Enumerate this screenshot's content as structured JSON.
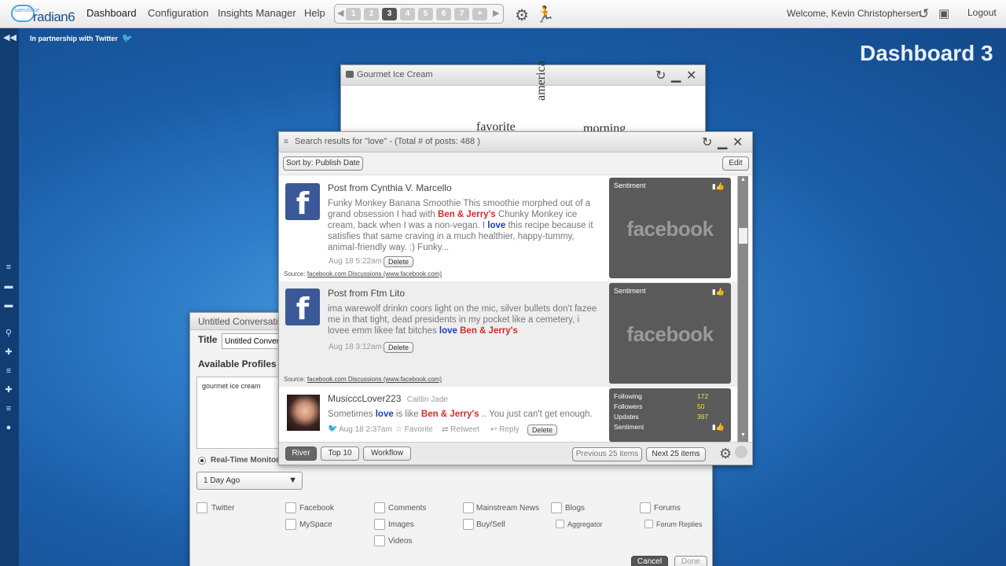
{
  "topbar": {
    "logo_small": "salesforce",
    "logo_text": "radian6",
    "nav": [
      "Dashboard",
      "Configuration",
      "Insights Manager",
      "Help"
    ],
    "pages": [
      "1",
      "2",
      "3",
      "4",
      "5",
      "6",
      "7",
      "+"
    ],
    "active_page": "3",
    "welcome": "Welcome, Kevin Christophersen",
    "logout": "Logout"
  },
  "partner_text": "In partnership with Twitter",
  "dashboard_title": "Dashboard 3",
  "cloud_window": {
    "title": "Gourmet Ice Cream",
    "words": [
      "favorite",
      "america",
      "morning"
    ]
  },
  "search_window": {
    "title": "Search results for \"love\" - (Total # of posts: 488 )",
    "sort_label": "Sort by: Publish Date",
    "edit_label": "Edit",
    "posts": [
      {
        "title": "Post from Cynthia V. Marcello",
        "body_parts": [
          "Funky Monkey Banana Smoothie This smoothie morphed out of a grand obsession I had with ",
          "Ben & Jerry's",
          " Chunky Monkey ice cream, back when I was a non-vegan. I ",
          "love",
          " this recipe because it satisfies that same craving in a much healthier, happy-tummy, animal-friendly way. :) Funky..."
        ],
        "time": "Aug 18 5:22am",
        "delete": "Delete",
        "source_label": "Source:",
        "source": "facebook.com Discussions (www.facebook.com)",
        "sentiment": "Sentiment",
        "brand": "facebook"
      },
      {
        "title": "Post from Ftm Lito",
        "body_parts": [
          "ima warewolf drinkn coors light on the mic, silver bullets don't fazee me in that tight, dead presidents in my pocket like a cemetery, i lovee emm likee fat bitches ",
          "love",
          " ",
          "Ben & Jerry's"
        ],
        "time": "Aug 18 3:12am",
        "delete": "Delete",
        "source_label": "Source:",
        "source": "facebook.com Discussions (www.facebook.com)",
        "sentiment": "Sentiment",
        "brand": "facebook"
      },
      {
        "title": "MusicccLover223",
        "subtitle": "Caitlin Jade",
        "body_parts": [
          "Sometimes ",
          "love",
          " is like ",
          "Ben & Jerry's",
          " .. You just can't get enough."
        ],
        "time": "Aug 18 2:37am",
        "favorite": "Favorite",
        "retweet": "Retweet",
        "reply": "Reply",
        "delete": "Delete",
        "stats": [
          {
            "label": "Following",
            "value": "172"
          },
          {
            "label": "Followers",
            "value": "50"
          },
          {
            "label": "Updates",
            "value": "397"
          }
        ],
        "sentiment": "Sentiment"
      }
    ],
    "tabs": [
      "River",
      "Top 10",
      "Workflow"
    ],
    "prev": "Previous 25 items",
    "next": "Next 25 items"
  },
  "conv_window": {
    "title": "Untitled Conversation",
    "title_label": "Title",
    "title_value": "Untitled Conversa",
    "profiles_label": "Available Profiles",
    "profiles": [
      "gourmet ice cream"
    ],
    "realtime": "Real-Time Monitor",
    "range": "1 Day Ago",
    "media": [
      [
        "Twitter",
        "MySpace"
      ],
      [
        "Facebook"
      ],
      [
        "Comments",
        "Images",
        "Videos"
      ],
      [
        "Mainstream News",
        "Buy/Sell"
      ],
      [
        "Blogs",
        "Aggregator"
      ],
      [
        "Forums",
        "Forum Replies"
      ]
    ],
    "cancel": "Cancel",
    "done": "Done"
  },
  "colors": {
    "keyword_love": "#1e3fb5",
    "keyword_brand": "#d52b2b",
    "facebook_blue": "#3b5998",
    "sentiment_bg": "#5a5a5a"
  }
}
